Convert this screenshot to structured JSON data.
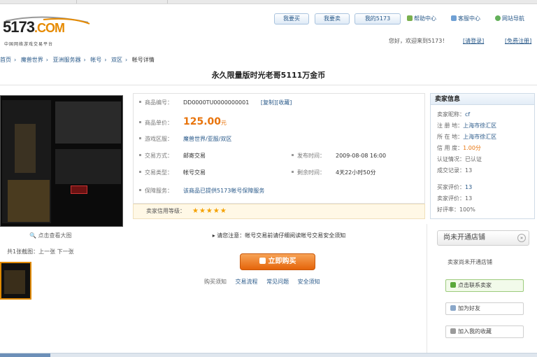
{
  "colors": {
    "accent": "#e8740c",
    "link": "#2a5a8a",
    "button_orange": "#f08a2c"
  },
  "logo": {
    "text_main": "5173",
    "text_com": ".COM",
    "tagline": "中国网络游戏交易平台"
  },
  "header": {
    "buttons": [
      "我要买",
      "我要卖",
      "我的5173"
    ],
    "links": [
      "帮助中心",
      "客服中心",
      "网站导航"
    ],
    "row2_text": "您好，欢迎来到5173！",
    "row2_login": "[请登录]",
    "row2_register": "[免费注册]"
  },
  "breadcrumb": [
    "首页",
    "魔兽世界",
    "亚洲服务器",
    "帐号",
    "双区",
    "帐号详情"
  ],
  "title": "永久限量版时光老哥5111万金币",
  "screenshot": {
    "zoom_label": "点击查看大图",
    "thumbs_label": "共1张截图：上一张 下一张"
  },
  "info": {
    "rows": [
      {
        "label": "商品编号：",
        "value": "DD0000TU0000000001",
        "link": "[复制][收藏]"
      },
      {
        "label": "商品单价：",
        "value": "125.00",
        "unit": "元"
      },
      {
        "label": "游戏区服：",
        "value": "魔兽世界/亚服/双区"
      },
      {
        "label": "交易方式：",
        "value": "邮寄交易",
        "label2": "发布时间：",
        "value2": "2009-08-08 16:00"
      },
      {
        "label": "交易类型：",
        "value": "帐号交易",
        "label2": "剩余时间：",
        "value2": "4天22小时50分"
      },
      {
        "label": "保障服务：",
        "value": "该商品已提供5173帐号保障服务"
      }
    ],
    "rating_label": "卖家信用等级：",
    "rating_stars": "★★★★★",
    "notice": "请您注意：帐号交易前请仔细阅读帐号交易安全须知",
    "buy_button": "立即购买",
    "below_prefix": "购买须知",
    "below_links": [
      "交易流程",
      "常见问题",
      "安全须知"
    ]
  },
  "seller": {
    "header": "卖家信息",
    "items": [
      {
        "label": "卖家昵称：",
        "value": "cf"
      },
      {
        "label": "注 册 地：",
        "value": "上海市徐汇区"
      },
      {
        "label": "所 在 地：",
        "value": "上海市徐汇区"
      },
      {
        "label": "信 用 度：",
        "value": "1.00分"
      },
      {
        "label": "认证情况：",
        "value": "已认证"
      },
      {
        "label": "成交记录：",
        "value": "13"
      },
      {
        "label": "买家评价：",
        "value": "13"
      },
      {
        "label": "卖家评价：",
        "value": "13"
      },
      {
        "label": "好评率：",
        "value": "100%"
      }
    ],
    "shop_button": "尚未开通店铺",
    "shop_arrow": "»",
    "shop_text": "卖家尚未开通店铺",
    "buttons": [
      "点击联系卖家",
      "加为好友",
      "加入我的收藏"
    ]
  }
}
